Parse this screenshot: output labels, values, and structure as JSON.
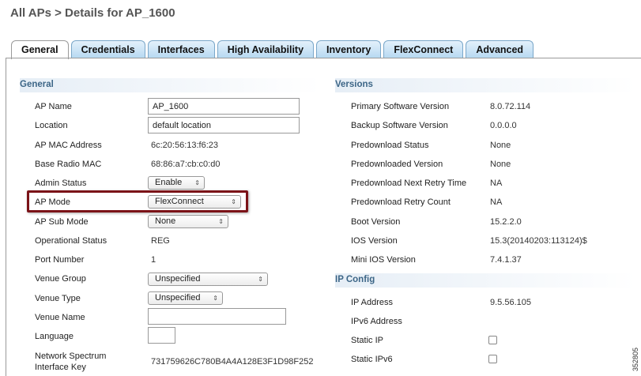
{
  "page": {
    "title": "All APs > Details for AP_1600"
  },
  "tabs": [
    {
      "label": "General",
      "active": true
    },
    {
      "label": "Credentials",
      "active": false
    },
    {
      "label": "Interfaces",
      "active": false
    },
    {
      "label": "High Availability",
      "active": false
    },
    {
      "label": "Inventory",
      "active": false
    },
    {
      "label": "FlexConnect",
      "active": false
    },
    {
      "label": "Advanced",
      "active": false
    }
  ],
  "general": {
    "header": "General",
    "ap_name": {
      "label": "AP Name",
      "value": "AP_1600"
    },
    "location": {
      "label": "Location",
      "value": "default location"
    },
    "ap_mac": {
      "label": "AP MAC Address",
      "value": "6c:20:56:13:f6:23"
    },
    "base_radio_mac": {
      "label": "Base Radio MAC",
      "value": "68:86:a7:cb:c0:d0"
    },
    "admin_status": {
      "label": "Admin Status",
      "value": "Enable"
    },
    "ap_mode": {
      "label": "AP Mode",
      "value": "FlexConnect"
    },
    "ap_sub_mode": {
      "label": "AP Sub Mode",
      "value": "None"
    },
    "operational_status": {
      "label": "Operational Status",
      "value": "REG"
    },
    "port_number": {
      "label": "Port Number",
      "value": "1"
    },
    "venue_group": {
      "label": "Venue Group",
      "value": "Unspecified"
    },
    "venue_type": {
      "label": "Venue Type",
      "value": "Unspecified"
    },
    "venue_name": {
      "label": "Venue Name",
      "value": ""
    },
    "language": {
      "label": "Language",
      "value": ""
    },
    "spectrum_key": {
      "label_line1": "Network Spectrum",
      "label_line2": "Interface Key",
      "value": "731759626C780B4A4A128E3F1D98F252"
    }
  },
  "versions": {
    "header": "Versions",
    "primary_sw": {
      "label": "Primary Software Version",
      "value": "8.0.72.114"
    },
    "backup_sw": {
      "label": "Backup Software Version",
      "value": "0.0.0.0"
    },
    "predownload_status": {
      "label": "Predownload Status",
      "value": "None"
    },
    "predownloaded_version": {
      "label": "Predownloaded Version",
      "value": "None"
    },
    "predownload_next_retry": {
      "label": "Predownload Next Retry Time",
      "value": "NA"
    },
    "predownload_retry_count": {
      "label": "Predownload Retry Count",
      "value": "NA"
    },
    "boot_version": {
      "label": "Boot Version",
      "value": "15.2.2.0"
    },
    "ios_version": {
      "label": "IOS Version",
      "value": "15.3(20140203:113124)$"
    },
    "mini_ios_version": {
      "label": "Mini IOS Version",
      "value": "7.4.1.37"
    }
  },
  "ip_config": {
    "header": "IP Config",
    "ip_address": {
      "label": "IP Address",
      "value": "9.5.56.105"
    },
    "ipv6_address": {
      "label": "IPv6 Address",
      "value": ""
    },
    "static_ip": {
      "label": "Static IP",
      "checked": false
    },
    "static_ipv6": {
      "label": "Static IPv6",
      "checked": false
    }
  },
  "figure_id": "352805",
  "colors": {
    "highlight": "#7b1318",
    "section_header": "#3d6687",
    "tab_inactive": "#b5d8f1"
  }
}
